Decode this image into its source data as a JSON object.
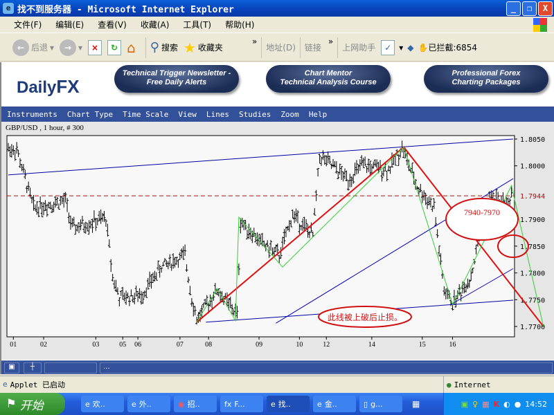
{
  "window": {
    "title": "找不到服务器 - Microsoft Internet Explorer",
    "min": "_",
    "max": "❐",
    "close": "X"
  },
  "menu": [
    "文件(F)",
    "编辑(E)",
    "查看(V)",
    "收藏(A)",
    "工具(T)",
    "帮助(H)"
  ],
  "toolbar": {
    "back": "后退",
    "search": "搜索",
    "favorites": "收藏夹",
    "address": "地址(D)",
    "links": "链接",
    "helper": "上网助手",
    "blocked": "已拦截:6854",
    "more": "»"
  },
  "banner": {
    "logo_a": "Daily",
    "logo_b": "FX",
    "buttons": [
      [
        "Technical Trigger Newsletter -",
        "Free Daily Alerts"
      ],
      [
        "Chart Mentor",
        "Technical Analysis Course"
      ],
      [
        "Professional Forex",
        "Charting Packages"
      ]
    ]
  },
  "applet_menu": [
    "Instruments",
    "Chart Type",
    "Time Scale",
    "View",
    "Lines",
    "Studies",
    "Zoom",
    "Help"
  ],
  "applet_bottom": {
    "dots": "..."
  },
  "status": {
    "text": "Applet 已启动",
    "zone": "Internet"
  },
  "taskbar": {
    "start": "开始",
    "tasks": [
      "欢..",
      "外..",
      "招..",
      "F...",
      "找..",
      "金..",
      "g..."
    ],
    "clock": "14:52"
  },
  "chart_data": {
    "type": "ohlc",
    "title": "GBP/USD , 1 hour, # 300",
    "ylim": [
      1.7685,
      1.8075
    ],
    "yticks": [
      "1.8050",
      "1.8000",
      "1.7900",
      "1.7850",
      "1.7800",
      "1.7750",
      "1.7700"
    ],
    "ytick_values": [
      1.805,
      1.8,
      1.79,
      1.785,
      1.78,
      1.775,
      1.77
    ],
    "current_price": {
      "label": "1.7944",
      "value": 1.7944
    },
    "bars": 300,
    "xticks": [
      {
        "label": "01",
        "bar": 3
      },
      {
        "label": "02",
        "bar": 21
      },
      {
        "label": "03",
        "bar": 52
      },
      {
        "label": "05",
        "bar": 68
      },
      {
        "label": "06",
        "bar": 77
      },
      {
        "label": "07",
        "bar": 102
      },
      {
        "label": "08",
        "bar": 119
      },
      {
        "label": "09",
        "bar": 149
      },
      {
        "label": "10",
        "bar": 173
      },
      {
        "label": "12",
        "bar": 189
      },
      {
        "label": "14",
        "bar": 216
      },
      {
        "label": "15",
        "bar": 246
      },
      {
        "label": "16",
        "bar": 264
      }
    ],
    "price_path": [
      [
        0,
        1.8032
      ],
      [
        5,
        1.803
      ],
      [
        9,
        1.7987
      ],
      [
        15,
        1.7922
      ],
      [
        34,
        1.7935
      ],
      [
        38,
        1.7883
      ],
      [
        58,
        1.7902
      ],
      [
        62,
        1.7793
      ],
      [
        66,
        1.7754
      ],
      [
        79,
        1.7758
      ],
      [
        91,
        1.7812
      ],
      [
        105,
        1.7832
      ],
      [
        109,
        1.7754
      ],
      [
        112,
        1.7713
      ],
      [
        124,
        1.7768
      ],
      [
        136,
        1.7722
      ],
      [
        138,
        1.7896
      ],
      [
        150,
        1.7858
      ],
      [
        161,
        1.7832
      ],
      [
        169,
        1.7909
      ],
      [
        181,
        1.787
      ],
      [
        185,
        1.8019
      ],
      [
        202,
        1.7974
      ],
      [
        210,
        1.8
      ],
      [
        226,
        1.7993
      ],
      [
        234,
        1.8034
      ],
      [
        243,
        1.7961
      ],
      [
        253,
        1.7922
      ],
      [
        259,
        1.7767
      ],
      [
        264,
        1.7744
      ],
      [
        275,
        1.7793
      ],
      [
        280,
        1.787
      ],
      [
        286,
        1.7942
      ],
      [
        298,
        1.7929
      ],
      [
        300,
        1.7961
      ]
    ],
    "lines": [
      {
        "name": "channel-upper",
        "color": "#0000a0",
        "points": [
          [
            0,
            1.7983
          ],
          [
            300,
            1.805
          ]
        ]
      },
      {
        "name": "channel-lower",
        "color": "#0000a0",
        "points": [
          [
            117.5,
            1.7708
          ],
          [
            300,
            1.7749
          ]
        ]
      },
      {
        "name": "trend-mid",
        "color": "#0000c0",
        "points": [
          [
            159,
            1.7706
          ],
          [
            300,
            1.7976
          ]
        ]
      },
      {
        "name": "trend-right",
        "color": "#0000c0",
        "points": [
          [
            263,
            1.7741
          ],
          [
            300,
            1.7808
          ]
        ]
      },
      {
        "name": "red-zigzag",
        "color": "#e01010",
        "points": [
          [
            112,
            1.7708
          ],
          [
            235,
            1.8035
          ],
          [
            318,
            1.77
          ]
        ]
      },
      {
        "name": "green-zigzag",
        "color": "#30d030",
        "points": [
          [
            112,
            1.7708
          ],
          [
            124,
            1.7771
          ],
          [
            135,
            1.7711
          ],
          [
            137,
            1.7904
          ],
          [
            163,
            1.7811
          ],
          [
            235,
            1.8035
          ],
          [
            264,
            1.7741
          ],
          [
            299,
            1.7963
          ],
          [
            318,
            1.77
          ]
        ]
      }
    ],
    "annotations": [
      "7940-7970",
      "此线被上破后止损。"
    ],
    "colors": {
      "annotation": "#d01010",
      "price_line": "#a01010"
    }
  }
}
